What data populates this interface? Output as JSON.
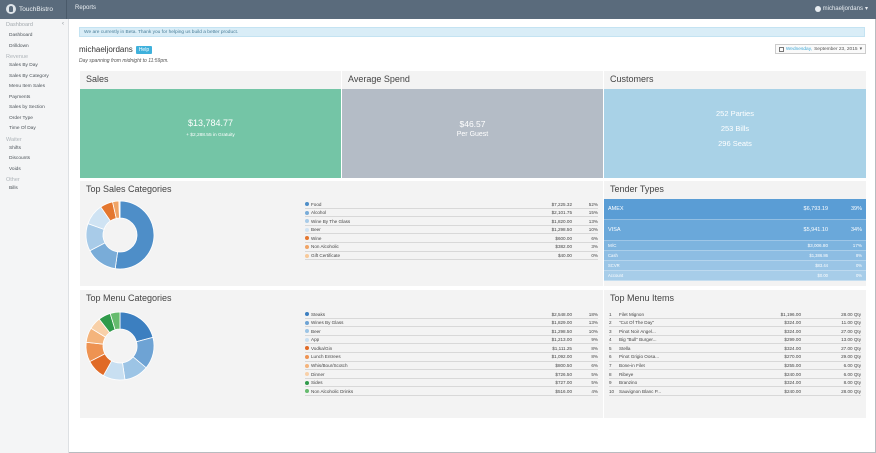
{
  "nav": {
    "brand": "TouchBistro",
    "reports": "Reports",
    "user": "michaeljordans"
  },
  "sidebar": {
    "head": "Dashboard",
    "items": [
      {
        "type": "item",
        "label": "Dashboard"
      },
      {
        "type": "item",
        "label": "Drilldown"
      },
      {
        "type": "section",
        "label": "Revenue"
      },
      {
        "type": "item",
        "label": "Sales By Day"
      },
      {
        "type": "item",
        "label": "Sales By Category"
      },
      {
        "type": "item",
        "label": "Menu Item Sales"
      },
      {
        "type": "item",
        "label": "Payments"
      },
      {
        "type": "item",
        "label": "Sales by Section"
      },
      {
        "type": "item",
        "label": "Order Type"
      },
      {
        "type": "item",
        "label": "Time Of Day"
      },
      {
        "type": "section",
        "label": "Waiter"
      },
      {
        "type": "item",
        "label": "Shifts"
      },
      {
        "type": "item",
        "label": "Discounts"
      },
      {
        "type": "item",
        "label": "Voids"
      },
      {
        "type": "section",
        "label": "Other"
      },
      {
        "type": "item",
        "label": "Bills"
      }
    ]
  },
  "beta_text": "We are currently in Beta. Thank you for helping us build a better product.",
  "user": {
    "name": "michaeljordans",
    "help": "Help",
    "span_note": "Day spanning from midnight to 11:59pm."
  },
  "date": {
    "day": "Wednesday,",
    "date": "September 23, 2015",
    "arrow": "▾"
  },
  "sales": {
    "title": "Sales",
    "amount": "$13,784.77",
    "sub": "+ $2,288.55 in Gratuity",
    "color": "#74c5a6"
  },
  "avg": {
    "title": "Average Spend",
    "amount": "$46.57",
    "sub": "Per Guest",
    "color": "#b4bcc6"
  },
  "customers": {
    "title": "Customers",
    "parties": "252 Parties",
    "bills": "253 Bills",
    "seats": "296 Seats",
    "color": "#a9d2e7"
  },
  "top_sales": {
    "title": "Top Sales Categories",
    "rows": [
      {
        "name": "Food",
        "amount": "$7,225.32",
        "pct": "52%",
        "value": 52,
        "color": "#4e8ec8"
      },
      {
        "name": "Alcohol",
        "amount": "$2,101.75",
        "pct": "15%",
        "value": 15,
        "color": "#79acd8"
      },
      {
        "name": "Wine By The Glass",
        "amount": "$1,820.00",
        "pct": "13%",
        "value": 13,
        "color": "#a8cbe8"
      },
      {
        "name": "Beer",
        "amount": "$1,298.50",
        "pct": "10%",
        "value": 10,
        "color": "#cfe3f3"
      },
      {
        "name": "Wine",
        "amount": "$600.00",
        "pct": "6%",
        "value": 6,
        "color": "#e4772f"
      },
      {
        "name": "Non Alcoholic",
        "amount": "$382.00",
        "pct": "3%",
        "value": 3,
        "color": "#f0a466"
      },
      {
        "name": "Gift Certificate",
        "amount": "$40.00",
        "pct": "0%",
        "value": 0.5,
        "color": "#f7c99a"
      }
    ]
  },
  "tender": {
    "title": "Tender Types",
    "rows": [
      {
        "name": "AMEX",
        "amount": "$6,793.19",
        "pct": "39%",
        "color": "#5a9dd5"
      },
      {
        "name": "VISA",
        "amount": "$5,941.10",
        "pct": "34%",
        "color": "#6aa8da"
      },
      {
        "name": "M/C",
        "amount": "$3,006.80",
        "pct": "17%",
        "color": "#7db4df"
      },
      {
        "name": "Cash",
        "amount": "$1,386.86",
        "pct": "8%",
        "color": "#8dbde3"
      },
      {
        "name": "SCVR",
        "amount": "$83.44",
        "pct": "0%",
        "color": "#9ac5e6"
      },
      {
        "name": "Account",
        "amount": "$0.00",
        "pct": "0%",
        "color": "#a7cde9"
      }
    ]
  },
  "top_menu_cats": {
    "title": "Top Menu Categories",
    "rows": [
      {
        "name": "Steaks",
        "amount": "$2,548.00",
        "pct": "18%",
        "value": 18,
        "color": "#3c7fc0"
      },
      {
        "name": "Wines By Glass",
        "amount": "$1,829.00",
        "pct": "13%",
        "value": 13,
        "color": "#6ea3d4"
      },
      {
        "name": "Beer",
        "amount": "$1,298.50",
        "pct": "10%",
        "value": 10,
        "color": "#9cc4e5"
      },
      {
        "name": "App",
        "amount": "$1,213.00",
        "pct": "9%",
        "value": 9,
        "color": "#c8dff1"
      },
      {
        "name": "Vodka/Gin",
        "amount": "$1,111.25",
        "pct": "8%",
        "value": 8,
        "color": "#e06a26"
      },
      {
        "name": "Lunch Entrees",
        "amount": "$1,092.00",
        "pct": "8%",
        "value": 8,
        "color": "#ee9352"
      },
      {
        "name": "Whis/Bour/Scotch",
        "amount": "$800.50",
        "pct": "6%",
        "value": 6,
        "color": "#f4b47c"
      },
      {
        "name": "Dinner",
        "amount": "$726.50",
        "pct": "5%",
        "value": 5,
        "color": "#f8d0a8"
      },
      {
        "name": "Sides",
        "amount": "$727.00",
        "pct": "5%",
        "value": 5,
        "color": "#2f9a4a"
      },
      {
        "name": "Non Alcoholic Drinks",
        "amount": "$516.00",
        "pct": "4%",
        "value": 4,
        "color": "#66bb6e"
      }
    ]
  },
  "top_menu_items": {
    "title": "Top Menu Items",
    "rows": [
      {
        "n": "1",
        "name": "Filet Mignon",
        "amount": "$1,196.00",
        "qty": "28.00 Qty"
      },
      {
        "n": "2",
        "name": "\"Cut Of The Day\"",
        "amount": "$324.00",
        "qty": "11.00 Qty"
      },
      {
        "n": "3",
        "name": "Pinot Noir Angel...",
        "amount": "$324.00",
        "qty": "27.00 Qty"
      },
      {
        "n": "4",
        "name": "Big \"Bull\" Burger...",
        "amount": "$299.00",
        "qty": "13.00 Qty"
      },
      {
        "n": "5",
        "name": "Stella",
        "amount": "$324.00",
        "qty": "27.00 Qty"
      },
      {
        "n": "6",
        "name": "Pinot Grigio Oosa...",
        "amount": "$270.00",
        "qty": "29.00 Qty"
      },
      {
        "n": "7",
        "name": "Bone-in Filet",
        "amount": "$255.00",
        "qty": "6.00 Qty"
      },
      {
        "n": "8",
        "name": "Ribeye",
        "amount": "$240.00",
        "qty": "6.00 Qty"
      },
      {
        "n": "9",
        "name": "Branzino",
        "amount": "$324.00",
        "qty": "8.00 Qty"
      },
      {
        "n": "10",
        "name": "Sauvignon Blanc P...",
        "amount": "$240.00",
        "qty": "28.00 Qty"
      }
    ]
  }
}
